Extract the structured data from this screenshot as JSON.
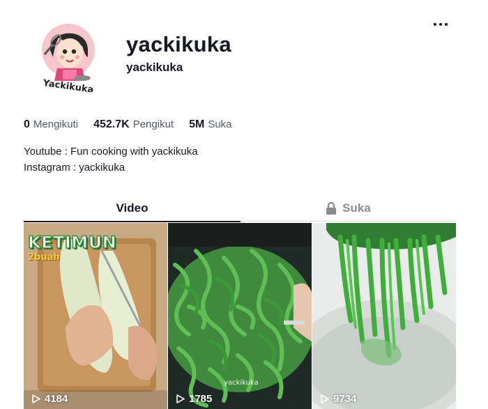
{
  "profile": {
    "username": "yackikuka",
    "nickname": "yackikuka",
    "avatar_label": "Yackikuka",
    "avatar_icon": "chef-girl-avatar"
  },
  "stats": {
    "following_count": "0",
    "following_label": "Mengikuti",
    "followers_count": "452.7K",
    "followers_label": "Pengikut",
    "likes_count": "5M",
    "likes_label": "Suka"
  },
  "bio": {
    "line1": "Youtube : Fun cooking with yackikuka",
    "line2": "Instagram : yackikuka"
  },
  "tabs": {
    "videos_label": "Video",
    "liked_label": "Suka",
    "liked_icon": "lock-icon"
  },
  "videos": [
    {
      "views": "4184",
      "overlay_title": "KETIMUN",
      "overlay_sub": "2buah"
    },
    {
      "views": "1785",
      "watermark": "yackikuka"
    },
    {
      "views": "9734"
    }
  ],
  "colors": {
    "text_primary": "#161823",
    "text_secondary": "#545864",
    "tab_inactive": "#8a8b91",
    "divider": "#e3e3e4"
  }
}
